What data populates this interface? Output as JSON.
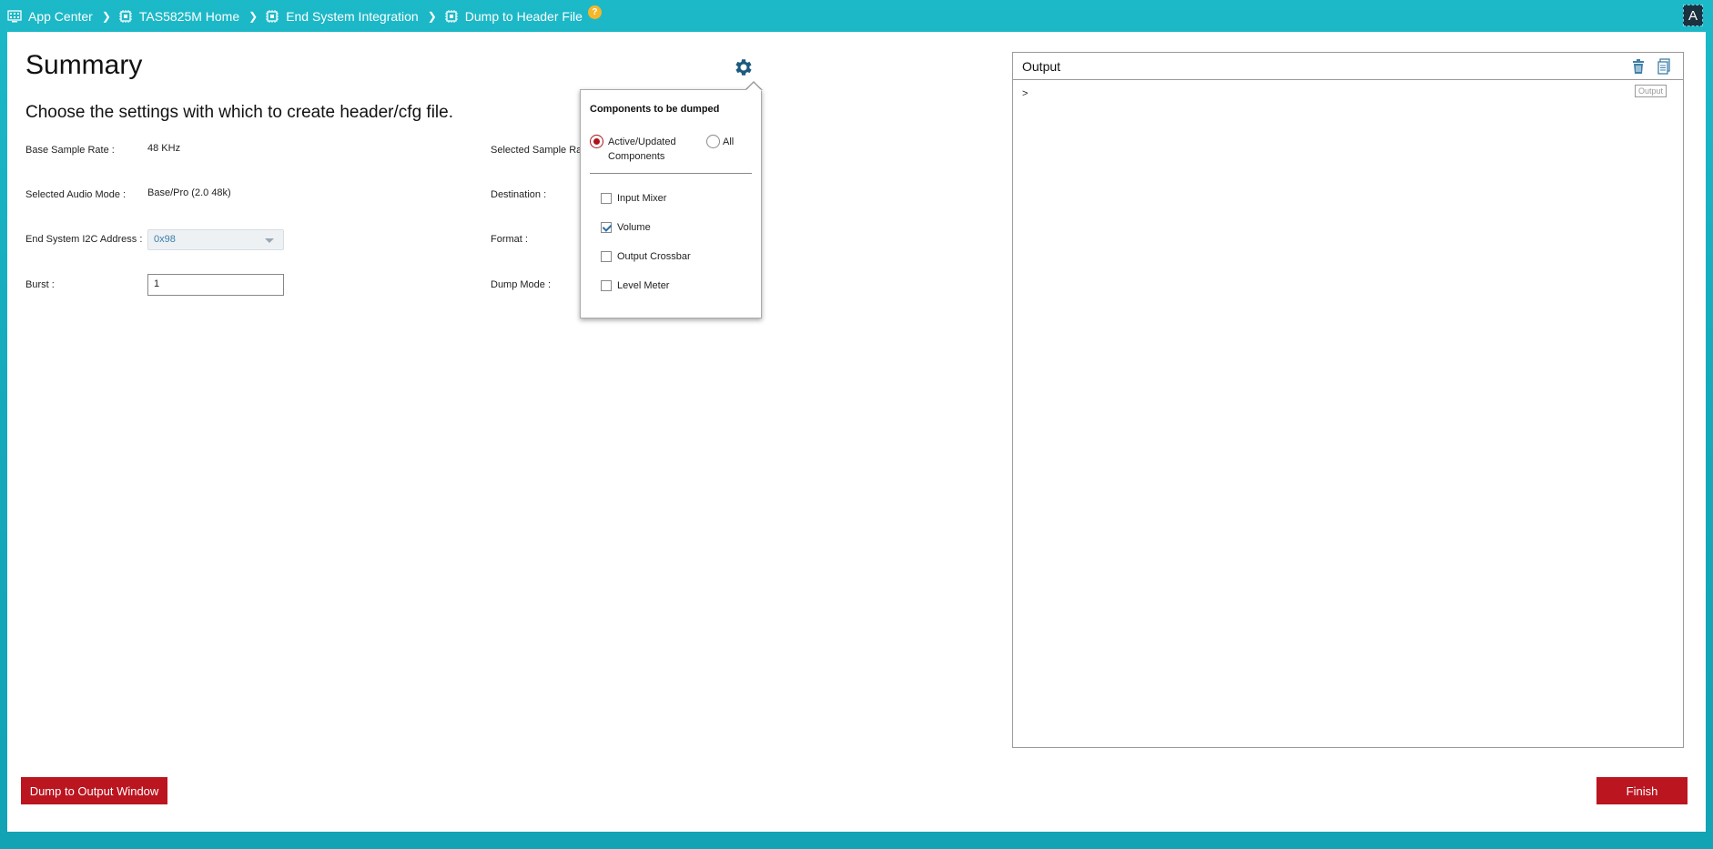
{
  "breadcrumbs": [
    {
      "label": "App Center",
      "icon": "grid-icon"
    },
    {
      "label": "TAS5825M Home",
      "icon": "chip-icon"
    },
    {
      "label": "End System Integration",
      "icon": "chip-icon"
    },
    {
      "label": "Dump to Header File",
      "icon": "chip-icon"
    }
  ],
  "help_badge": "?",
  "user_avatar": "A",
  "main": {
    "title": "Summary",
    "subtitle": "Choose the settings with which to create header/cfg file.",
    "fields": {
      "base_sample_rate": {
        "label": "Base Sample Rate :",
        "value": "48 KHz"
      },
      "selected_audio_mode": {
        "label": "Selected Audio Mode :",
        "value": "Base/Pro (2.0 48k)"
      },
      "i2c_address": {
        "label": "End System I2C Address :",
        "value": "0x98"
      },
      "burst": {
        "label": "Burst :",
        "value": "1"
      },
      "selected_sample_rate": {
        "label": "Selected Sample Ra"
      },
      "destination": {
        "label": "Destination :"
      },
      "format": {
        "label": "Format :"
      },
      "dump_mode": {
        "label": "Dump Mode :"
      }
    }
  },
  "popup": {
    "title": "Components to be dumped",
    "radio_options": [
      {
        "label_line1": "Active/Updated",
        "label_line2": "Components",
        "selected": true
      },
      {
        "label_line1": "All",
        "label_line2": "",
        "selected": false
      }
    ],
    "components": [
      {
        "label": "Input Mixer",
        "checked": false
      },
      {
        "label": "Volume",
        "checked": true
      },
      {
        "label": "Output Crossbar",
        "checked": false
      },
      {
        "label": "Level Meter",
        "checked": false
      }
    ]
  },
  "output": {
    "title": "Output",
    "prompt": ">",
    "tag": "Output"
  },
  "buttons": {
    "dump": "Dump to Output Window",
    "finish": "Finish"
  },
  "colors": {
    "accent_red": "#bb1520",
    "teal_background": "#1cb9c8",
    "gear_blue": "#1c5a80"
  }
}
